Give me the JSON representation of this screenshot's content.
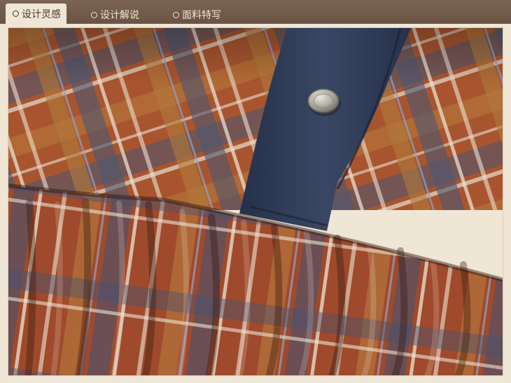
{
  "tabs": [
    {
      "label": "设计灵感",
      "active": true
    },
    {
      "label": "设计解说",
      "active": false
    },
    {
      "label": "面料特写",
      "active": false
    }
  ],
  "colors": {
    "bar": "#6d5646",
    "bar_text": "#efe3d3",
    "active_tab_bg": "#efe6d5",
    "plaid_base": "#a8552f",
    "plaid_blue": "#4b5672",
    "placket": "#2f3a52"
  },
  "icons": {
    "tab_marker": "circle-outline-icon",
    "button": "metal-snap-button"
  }
}
